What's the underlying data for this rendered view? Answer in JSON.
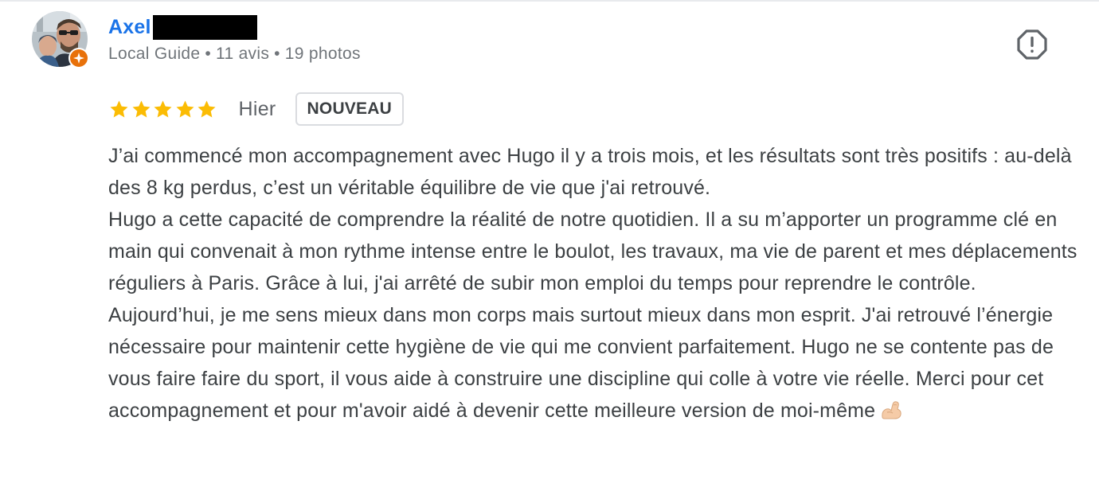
{
  "reviewer": {
    "name": "Axel",
    "meta": {
      "level": "Local Guide",
      "reviews": "11 avis",
      "photos": "19 photos",
      "separator": "•"
    }
  },
  "review": {
    "rating": 5,
    "max_rating": 5,
    "date": "Hier",
    "badge": "NOUVEAU",
    "paragraphs": [
      "J’ai commencé mon accompagnement avec Hugo il y a trois mois, et les résultats sont très positifs : au-delà des 8 kg perdus, c’est un véritable équilibre de vie que j'ai retrouvé.",
      "Hugo a cette capacité de comprendre la réalité de notre quotidien. Il a su m’apporter un programme clé en main qui convenait à mon rythme intense entre le boulot, les travaux, ma vie de parent et mes déplacements réguliers à Paris. Grâce à lui, j'ai arrêté de subir mon emploi du temps pour reprendre le contrôle.",
      "Aujourd’hui, je me sens mieux dans mon corps mais surtout mieux dans mon esprit. J'ai retrouvé l’énergie nécessaire pour maintenir cette hygiène de vie qui me convient parfaitement. Hugo ne se contente pas de vous faire faire du sport, il vous aide à construire une discipline qui colle à votre vie réelle. Merci pour cet accompagnement et pour m'avoir aidé à devenir cette meilleure version de moi-même"
    ]
  },
  "icons": {
    "flag": "report-icon",
    "star": "star-icon",
    "badge": "local-guide-badge-icon",
    "emoji": "flexed-biceps-emoji"
  },
  "colors": {
    "name": "#1a73e8",
    "star": "#fbbc04",
    "meta": "#70757a",
    "body_text": "#3c4043",
    "guide_badge": "#e8710a"
  }
}
